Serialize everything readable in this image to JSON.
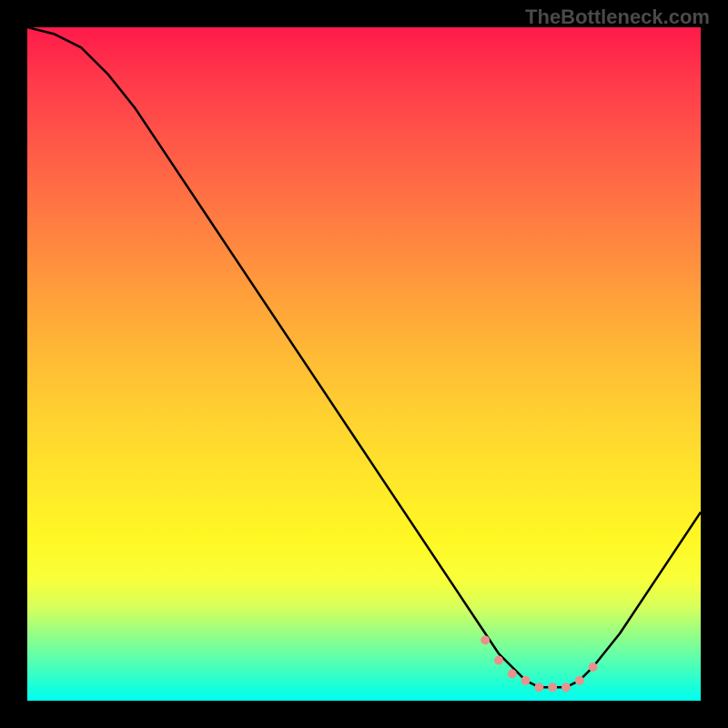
{
  "watermark": "TheBottleneck.com",
  "chart_data": {
    "type": "line",
    "title": "",
    "xlabel": "",
    "ylabel": "",
    "xlim": [
      0,
      100
    ],
    "ylim": [
      0,
      100
    ],
    "series": [
      {
        "name": "bottleneck-curve",
        "x": [
          0,
          4,
          8,
          12,
          16,
          20,
          24,
          28,
          32,
          36,
          40,
          44,
          48,
          52,
          56,
          60,
          64,
          68,
          70,
          72,
          74,
          76,
          78,
          80,
          82,
          84,
          88,
          92,
          96,
          100
        ],
        "values": [
          100,
          99,
          97,
          93,
          88,
          82,
          76,
          70,
          64,
          58,
          52,
          46,
          40,
          34,
          28,
          22,
          16,
          10,
          7,
          5,
          3,
          2,
          2,
          2,
          3,
          5,
          10,
          16,
          22,
          28
        ]
      }
    ],
    "markers": {
      "name": "highlight-dots",
      "x": [
        68,
        70,
        72,
        74,
        76,
        78,
        80,
        82,
        84
      ],
      "values": [
        9,
        6,
        4,
        3,
        2,
        2,
        2,
        3,
        5
      ]
    },
    "gradient_stops": [
      {
        "pos": 0,
        "color": "#ff1a4a"
      },
      {
        "pos": 18,
        "color": "#ff5a48"
      },
      {
        "pos": 38,
        "color": "#ff9a3c"
      },
      {
        "pos": 58,
        "color": "#ffd230"
      },
      {
        "pos": 76,
        "color": "#fff824"
      },
      {
        "pos": 89,
        "color": "#a8ff7a"
      },
      {
        "pos": 100,
        "color": "#00fff0"
      }
    ]
  }
}
